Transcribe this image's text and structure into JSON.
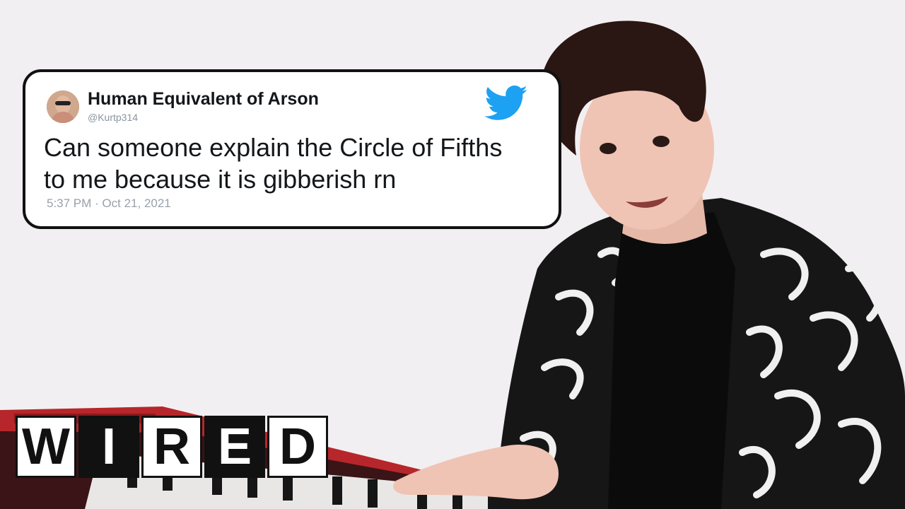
{
  "tweet": {
    "display_name": "Human Equivalent of Arson",
    "handle": "@Kurtp314",
    "text_line1": "Can someone explain the Circle of Fifths",
    "text_line2": "to me because it is gibberish rn",
    "timestamp": "5:37 PM · Oct 21, 2021",
    "brand_icon": "twitter-bird-icon",
    "brand_color": "#1da1f2"
  },
  "logo": {
    "letters": [
      "W",
      "I",
      "R",
      "E",
      "D"
    ]
  }
}
